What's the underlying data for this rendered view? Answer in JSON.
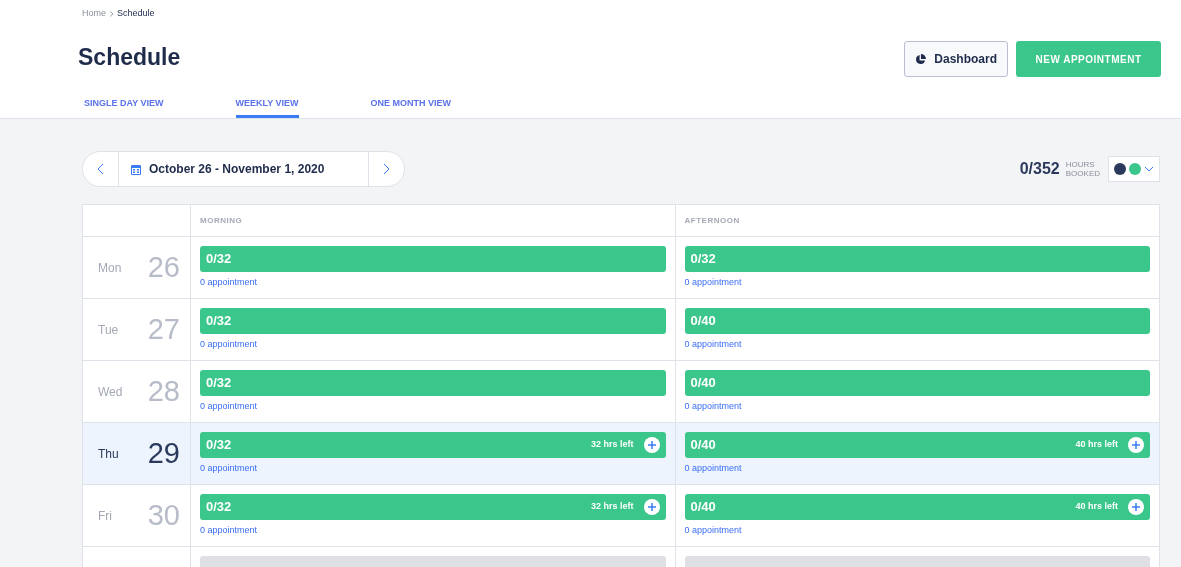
{
  "breadcrumb": [
    "Home",
    "Schedule"
  ],
  "title": "Schedule",
  "tabs": [
    {
      "label": "SINGLE DAY VIEW",
      "selected": false
    },
    {
      "label": "WEEKLY VIEW",
      "selected": true
    },
    {
      "label": "ONE MONTH VIEW",
      "selected": false
    }
  ],
  "buttons": {
    "dashboard": "Dashboard",
    "new_appointment": "NEW APPOINTMENT"
  },
  "date_range": "October 26 - November 1, 2020",
  "hours": {
    "value": "0/352",
    "label_top": "HOURS",
    "label_bottom": "BOOKED"
  },
  "legend": [
    {
      "color": "#2b3a5c"
    },
    {
      "color": "#3bc68b"
    }
  ],
  "columns": [
    "MORNING",
    "AFTERNOON"
  ],
  "rows": [
    {
      "kind": "day",
      "weekday": "Mon",
      "date": "26",
      "selected": false,
      "cells": [
        {
          "count": "0/32",
          "appointments": "0 appointment"
        },
        {
          "count": "0/32",
          "appointments": "0 appointment"
        }
      ]
    },
    {
      "kind": "day",
      "weekday": "Tue",
      "date": "27",
      "selected": false,
      "cells": [
        {
          "count": "0/32",
          "appointments": "0 appointment"
        },
        {
          "count": "0/40",
          "appointments": "0 appointment"
        }
      ]
    },
    {
      "kind": "day",
      "weekday": "Wed",
      "date": "28",
      "selected": false,
      "cells": [
        {
          "count": "0/32",
          "appointments": "0 appointment"
        },
        {
          "count": "0/40",
          "appointments": "0 appointment"
        }
      ]
    },
    {
      "kind": "day",
      "weekday": "Thu",
      "date": "29",
      "selected": true,
      "cells": [
        {
          "count": "0/32",
          "remaining": "32 hrs left",
          "appointments": "0 appointment"
        },
        {
          "count": "0/40",
          "remaining": "40 hrs left",
          "appointments": "0 appointment"
        }
      ]
    },
    {
      "kind": "day",
      "weekday": "Fri",
      "date": "30",
      "selected": false,
      "cells": [
        {
          "count": "0/32",
          "remaining": "32 hrs left",
          "appointments": "0 appointment"
        },
        {
          "count": "0/40",
          "remaining": "40 hrs left",
          "appointments": "0 appointment"
        }
      ]
    },
    {
      "kind": "empty"
    }
  ]
}
